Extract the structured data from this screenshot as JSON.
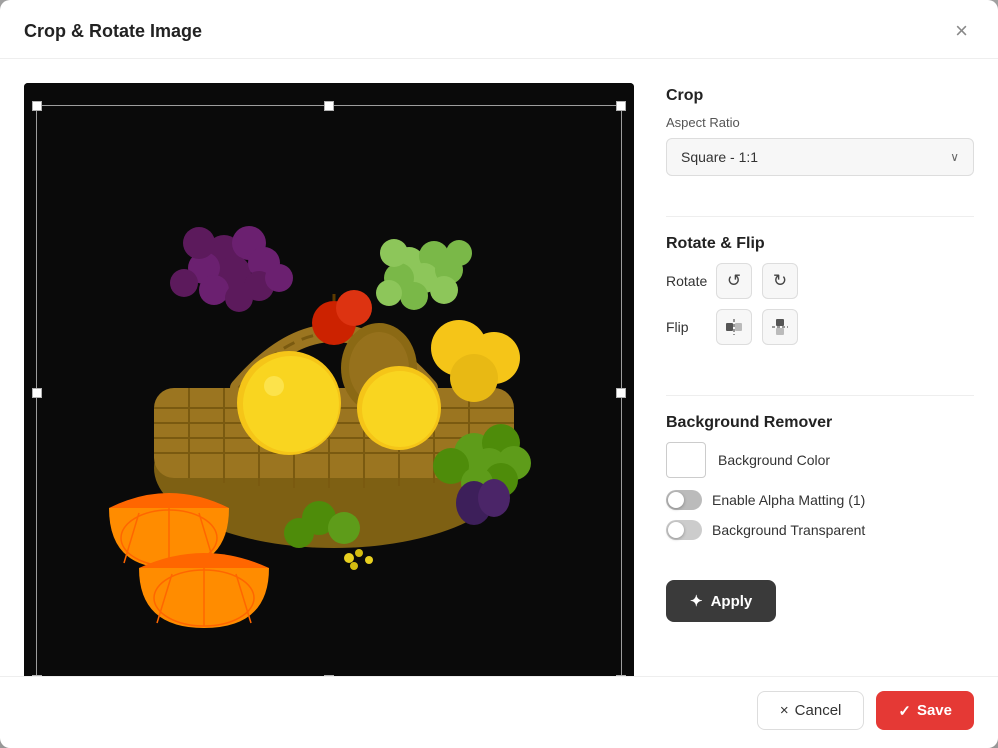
{
  "dialog": {
    "title": "Crop & Rotate Image",
    "close_label": "×"
  },
  "crop_section": {
    "title": "Crop",
    "aspect_ratio_label": "Aspect Ratio",
    "aspect_ratio_value": "Square - 1:1",
    "chevron": "∨"
  },
  "rotate_section": {
    "title": "Rotate & Flip",
    "rotate_label": "Rotate",
    "flip_label": "Flip",
    "rotate_ccw_icon": "↺",
    "rotate_cw_icon": "↻",
    "flip_h_icon": "⇔",
    "flip_v_icon": "⇕"
  },
  "bg_section": {
    "title": "Background Remover",
    "bg_color_label": "Background Color",
    "alpha_matting_label": "Enable Alpha Matting (1)",
    "bg_transparent_label": "Background Transparent"
  },
  "buttons": {
    "apply_label": "Apply",
    "apply_icon": "✦",
    "cancel_label": "Cancel",
    "cancel_icon": "×",
    "save_label": "Save",
    "save_icon": "✓"
  }
}
